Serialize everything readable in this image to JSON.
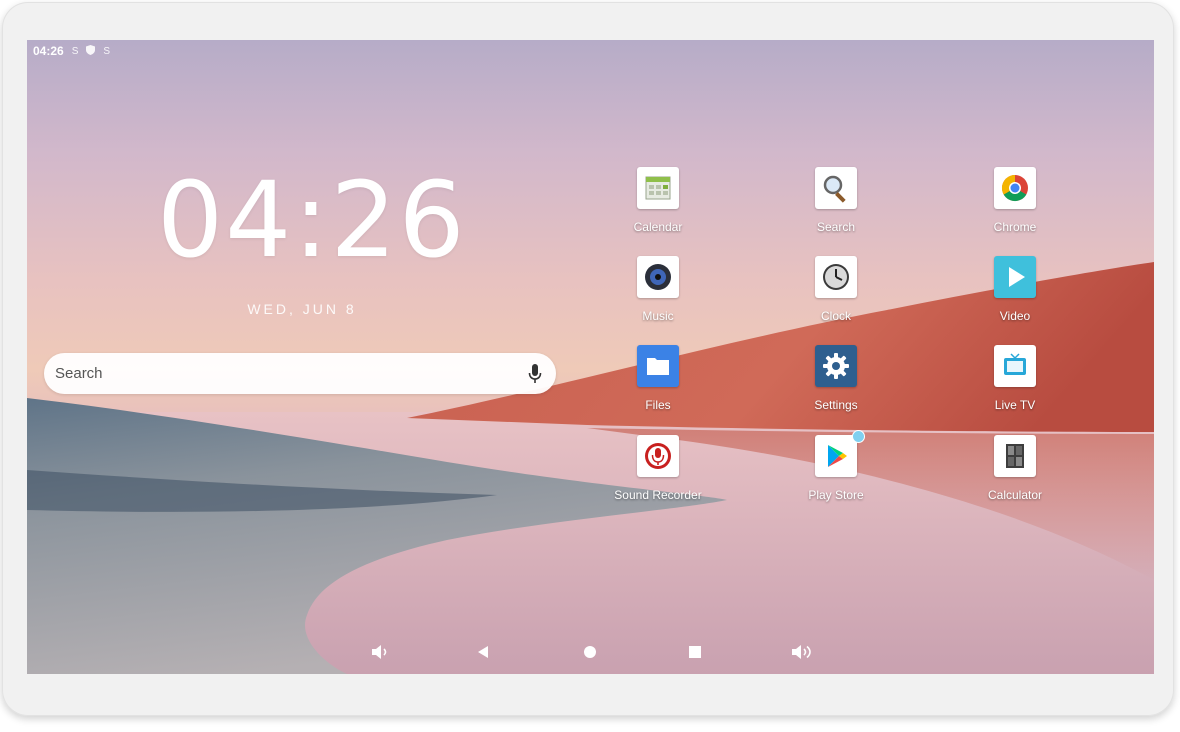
{
  "status_bar": {
    "time": "04:26",
    "icons": [
      "s-icon",
      "shield-icon",
      "s-icon"
    ]
  },
  "clock_widget": {
    "time": "04:26",
    "date": "WED, JUN 8"
  },
  "search": {
    "placeholder": "Search",
    "icons": [
      "mic-icon"
    ]
  },
  "apps": [
    {
      "label": "Calendar",
      "icon": "calendar-icon"
    },
    {
      "label": "Search",
      "icon": "magnifier-icon"
    },
    {
      "label": "Chrome",
      "icon": "chrome-icon"
    },
    {
      "label": "Music",
      "icon": "music-icon"
    },
    {
      "label": "Clock",
      "icon": "clock-icon"
    },
    {
      "label": "Video",
      "icon": "video-play-icon"
    },
    {
      "label": "Files",
      "icon": "folder-icon"
    },
    {
      "label": "Settings",
      "icon": "gear-icon"
    },
    {
      "label": "Live TV",
      "icon": "tv-icon"
    },
    {
      "label": "Sound Recorder",
      "icon": "mic-record-icon"
    },
    {
      "label": "Play Store",
      "icon": "play-store-icon"
    },
    {
      "label": "Calculator",
      "icon": "calculator-icon"
    }
  ],
  "nav_bar": {
    "icons": [
      "volume-down-icon",
      "back-icon",
      "home-icon",
      "recents-icon",
      "volume-up-icon"
    ]
  },
  "colors": {
    "settings_tile": "#2e5f8f",
    "files_tile": "#3b82e6",
    "video_tile": "#3fc0dc",
    "notification_dot": "#7fd0f0"
  }
}
